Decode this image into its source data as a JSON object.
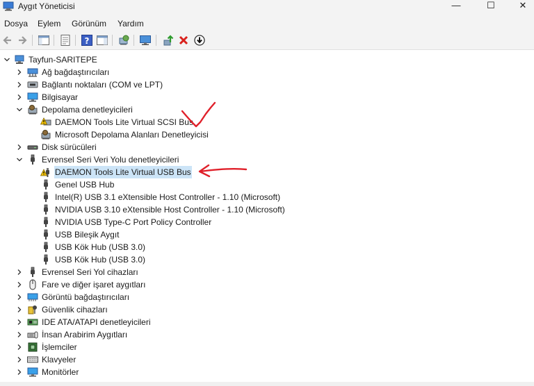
{
  "window": {
    "title": "Aygıt Yöneticisi",
    "minimize": "—",
    "maximize": "☐",
    "close": "✕"
  },
  "menu": [
    {
      "label": "Dosya"
    },
    {
      "label": "Eylem"
    },
    {
      "label": "Görünüm"
    },
    {
      "label": "Yardım"
    }
  ],
  "toolbar": [
    {
      "icon": "back-arrow-icon"
    },
    {
      "icon": "forward-arrow-icon"
    },
    {
      "icon": "console-tree-icon"
    },
    {
      "icon": "properties-icon"
    },
    {
      "icon": "help-icon"
    },
    {
      "icon": "action-view-icon"
    },
    {
      "icon": "scan-hardware-icon"
    },
    {
      "icon": "monitor-icon"
    },
    {
      "icon": "update-driver-icon"
    },
    {
      "icon": "uninstall-icon"
    },
    {
      "icon": "download-icon"
    }
  ],
  "tree": [
    {
      "label": "Tayfun-SARITEPE",
      "expanded": true
    },
    {
      "label": "Ağ bağdaştırıcıları"
    },
    {
      "label": "Bağlantı noktaları (COM ve LPT)"
    },
    {
      "label": "Bilgisayar"
    },
    {
      "label": "Depolama denetleyicileri",
      "expanded": true
    },
    {
      "label": "DAEMON Tools Lite Virtual SCSI Bus",
      "warning": true
    },
    {
      "label": "Microsoft Depolama Alanları Denetleyicisi"
    },
    {
      "label": "Disk sürücüleri"
    },
    {
      "label": "Evrensel Seri Veri Yolu denetleyicileri",
      "expanded": true
    },
    {
      "label": "DAEMON Tools Lite Virtual USB Bus",
      "warning": true,
      "selected": true
    },
    {
      "label": "Genel USB Hub"
    },
    {
      "label": "Intel(R) USB 3.1 eXtensible Host Controller - 1.10 (Microsoft)"
    },
    {
      "label": "NVIDIA USB 3.10 eXtensible Host Controller - 1.10 (Microsoft)"
    },
    {
      "label": "NVIDIA USB Type-C Port Policy Controller"
    },
    {
      "label": "USB Bileşik Aygıt"
    },
    {
      "label": "USB Kök Hub (USB 3.0)"
    },
    {
      "label": "USB Kök Hub (USB 3.0)"
    },
    {
      "label": "Evrensel Seri Yol cihazları"
    },
    {
      "label": "Fare ve diğer işaret aygıtları"
    },
    {
      "label": "Görüntü bağdaştırıcıları"
    },
    {
      "label": "Güvenlik cihazları"
    },
    {
      "label": "IDE ATA/ATAPI denetleyicileri"
    },
    {
      "label": "İnsan Arabirim Aygıtları"
    },
    {
      "label": "İşlemciler"
    },
    {
      "label": "Klavyeler"
    },
    {
      "label": "Monitörler"
    }
  ],
  "colors": {
    "warning": "#f5c400",
    "selected": "#cce4f7",
    "annotation": "#e0202a",
    "uninstall": "#d9211c"
  }
}
